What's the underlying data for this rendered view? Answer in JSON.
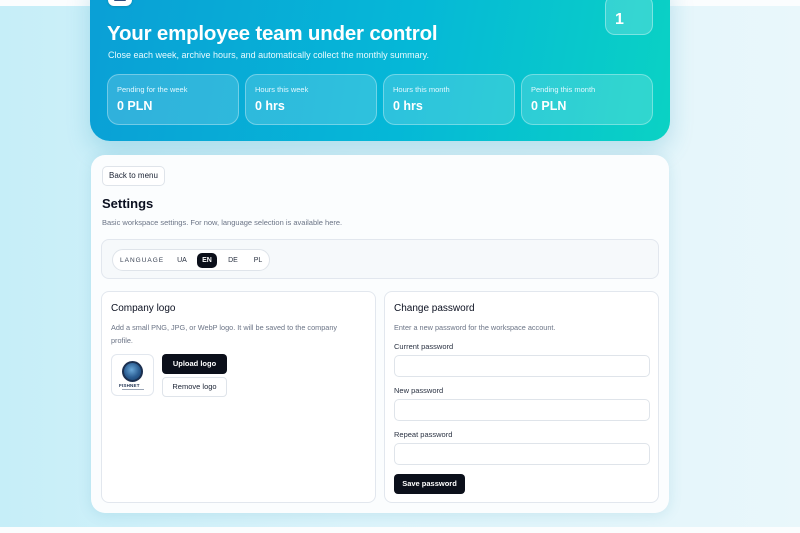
{
  "hero": {
    "title": "Your employee team under control",
    "subtitle": "Close each week, archive hours, and automatically collect the monthly summary.",
    "count": "1",
    "stats": [
      {
        "label": "Pending for the week",
        "value": "0 PLN"
      },
      {
        "label": "Hours this week",
        "value": "0 hrs"
      },
      {
        "label": "Hours this month",
        "value": "0 hrs"
      },
      {
        "label": "Pending this month",
        "value": "0 PLN"
      }
    ]
  },
  "settings": {
    "back_label": "Back to menu",
    "title": "Settings",
    "subtitle": "Basic workspace settings. For now, language selection is available here.",
    "language": {
      "label": "LANGUAGE",
      "options": [
        "UA",
        "EN",
        "DE",
        "PL"
      ],
      "selected": "EN"
    },
    "company_logo": {
      "title": "Company logo",
      "description_line1": "Add a small PNG, JPG, or WebP logo. It will be saved to the company",
      "description_line2": "profile.",
      "logo_text": "FISHNET",
      "upload_label": "Upload logo",
      "remove_label": "Remove logo"
    },
    "change_password": {
      "title": "Change password",
      "description": "Enter a new password for the workspace account.",
      "current_label": "Current password",
      "current_value": "",
      "new_label": "New password",
      "new_value": "",
      "repeat_label": "Repeat password",
      "repeat_value": "",
      "save_label": "Save password"
    }
  },
  "colors": {
    "hero_gradient_start": "#0a9fd6",
    "hero_gradient_end": "#0ad2c4",
    "primary_button": "#0b0f1a",
    "background": "#d6f2fa"
  },
  "icons": [
    "company-logo-image"
  ]
}
